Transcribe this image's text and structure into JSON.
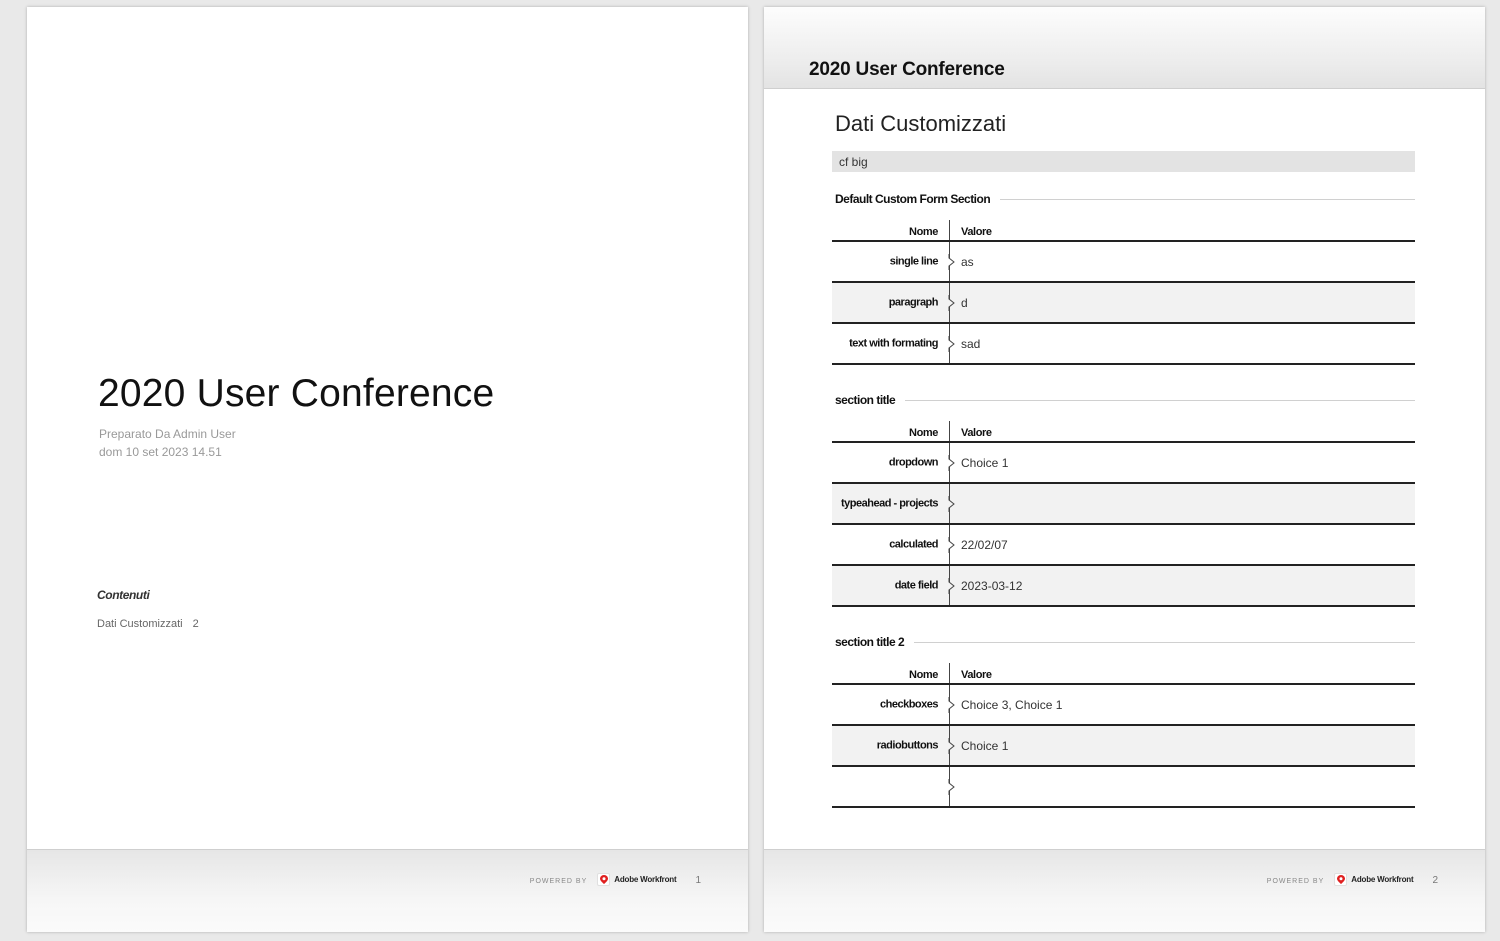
{
  "page1": {
    "title": "2020 User Conference",
    "prepared_by": "Preparato Da Admin User",
    "date": "dom 10 set 2023 14.51",
    "toc_heading": "Contenuti",
    "toc_items": [
      {
        "label": "Dati Customizzati",
        "page": "2"
      }
    ],
    "footer": {
      "powered_by": "POWERED BY",
      "brand": "Adobe Workfront",
      "page_number": "1"
    }
  },
  "page2": {
    "header_title": "2020 User Conference",
    "section_title": "Dati Customizzati",
    "form_name": "cf big",
    "sections": [
      {
        "title": "Default Custom Form Section",
        "col_name": "Nome",
        "col_value": "Valore",
        "rows": [
          {
            "name": "single line",
            "value": "as"
          },
          {
            "name": "paragraph",
            "value": "d"
          },
          {
            "name": "text with formating",
            "value": "sad"
          }
        ]
      },
      {
        "title": "section title",
        "col_name": "Nome",
        "col_value": "Valore",
        "rows": [
          {
            "name": "dropdown",
            "value": "Choice 1"
          },
          {
            "name": "typeahead - projects",
            "value": ""
          },
          {
            "name": "calculated",
            "value": "22/02/07"
          },
          {
            "name": "date field",
            "value": "2023-03-12"
          }
        ]
      },
      {
        "title": "section title 2",
        "col_name": "Nome",
        "col_value": "Valore",
        "rows": [
          {
            "name": "checkboxes",
            "value": "Choice 3, Choice 1"
          },
          {
            "name": "radiobuttons",
            "value": "Choice 1"
          },
          {
            "name": "",
            "value": ""
          }
        ]
      }
    ],
    "footer": {
      "powered_by": "POWERED BY",
      "brand": "Adobe Workfront",
      "page_number": "2"
    }
  },
  "colors": {
    "logo_red": "#e02020",
    "band_gray": "#e3e3e3",
    "row_alt": "#f2f2f2"
  }
}
